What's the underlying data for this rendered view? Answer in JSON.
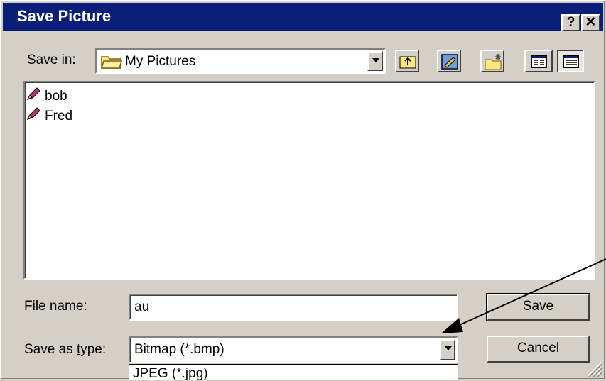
{
  "window": {
    "title": "Save Picture",
    "help_glyph": "?",
    "close_glyph": "✕"
  },
  "toolbar": {
    "save_in_label_pre": "Save ",
    "save_in_label_key": "i",
    "save_in_label_post": "n:",
    "location": "My Pictures"
  },
  "files": [
    {
      "name": "bob",
      "icon": "picture-file-icon"
    },
    {
      "name": "Fred",
      "icon": "picture-file-icon"
    }
  ],
  "file_name": {
    "label_pre": "File ",
    "label_key": "n",
    "label_post": "ame:",
    "value": "au"
  },
  "save_as_type": {
    "label_pre": "Save as ",
    "label_key": "t",
    "label_post": "ype:",
    "value": "Bitmap (*.bmp)",
    "dropdown_option": "JPEG (*.jpg)"
  },
  "buttons": {
    "save_key": "S",
    "save_rest": "ave",
    "cancel": "Cancel"
  },
  "colors": {
    "titlebar": "#0a1f7a",
    "face": "#d4d0c8"
  }
}
